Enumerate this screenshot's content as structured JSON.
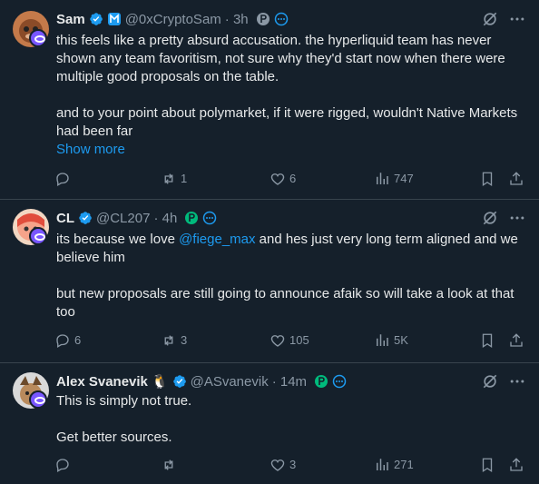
{
  "tweets": [
    {
      "name": "Sam",
      "handle": "@0xCryptoSam",
      "time": "· 3h",
      "text": [
        "this feels like a pretty absurd accusation. the hyperliquid team has never shown any team favoritism, not sure why they'd start now when there were multiple good proposals on the table.",
        "and to your point about polymarket, if it were rigged, wouldn't Native Markets had been far"
      ],
      "show_more": "Show more",
      "replies": "",
      "reposts": "1",
      "likes": "6",
      "views": "747"
    },
    {
      "name": "CL",
      "handle": "@CL207",
      "time": "· 4h",
      "text_a": "its because we love ",
      "mention": "@fiege_max",
      "text_b": " and hes just very long term aligned and we believe him",
      "text_c": "but new proposals are still going to announce afaik so will take a look at that too",
      "replies": "6",
      "reposts": "3",
      "likes": "105",
      "views": "5K"
    },
    {
      "name": "Alex Svanevik",
      "emoji": "🐧",
      "handle": "@ASvanevik",
      "time": "· 14m",
      "text": [
        "This is simply not true.",
        "Get better sources."
      ],
      "replies": "",
      "reposts": "",
      "likes": "3",
      "views": "271"
    }
  ],
  "colors": {
    "background": "#15202b",
    "text": "#e7e9ea",
    "muted": "#8b98a5",
    "accent": "#1d9bf0",
    "divider": "#38444d"
  },
  "icons": [
    "verified-icon",
    "affiliate-badge-icon",
    "grok-icon",
    "more-icon",
    "reply-icon",
    "repost-icon",
    "like-icon",
    "views-icon",
    "bookmark-icon",
    "share-icon"
  ]
}
